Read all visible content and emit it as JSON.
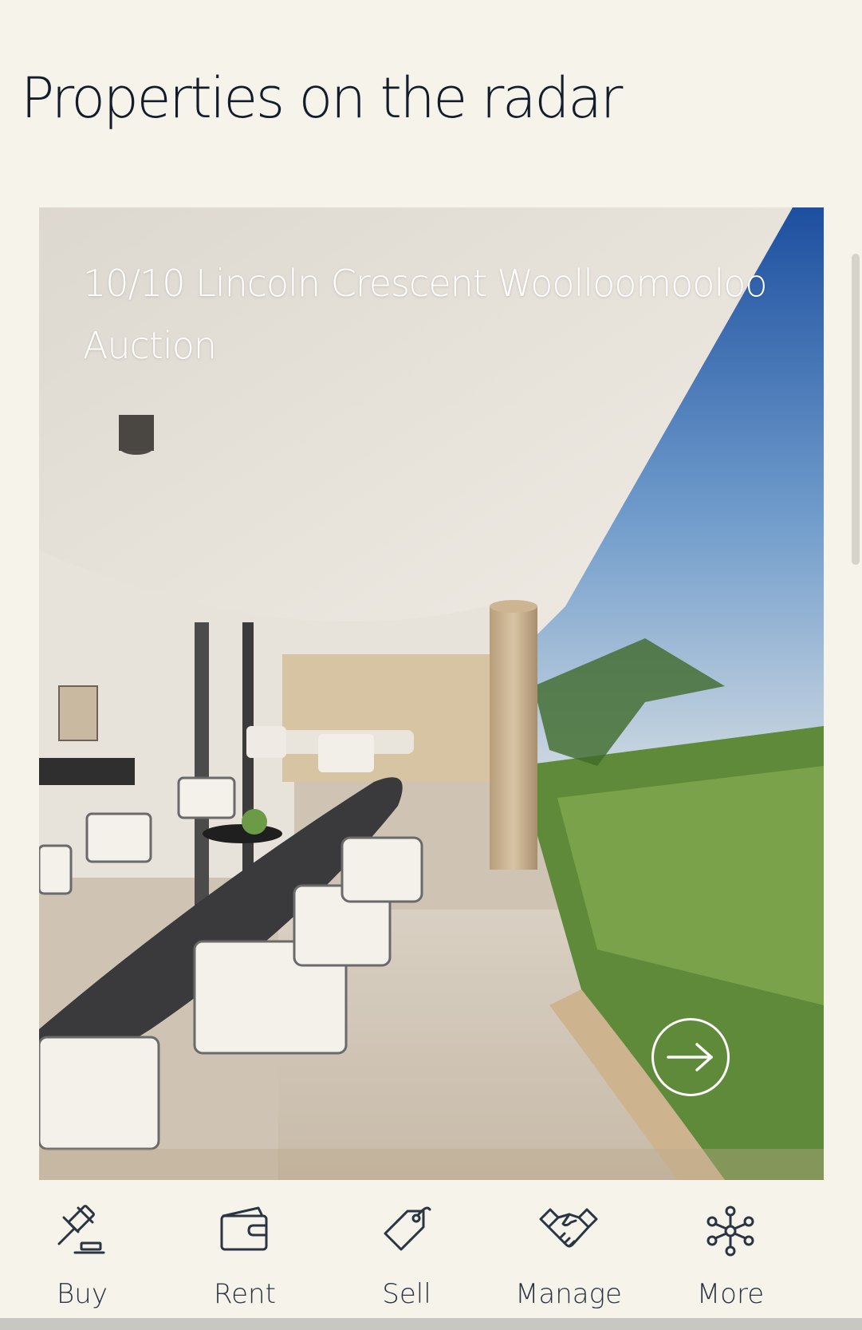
{
  "page": {
    "title": "Properties on the radar"
  },
  "listing": {
    "address": "10/10 Lincoln Crescent Woolloomooloo",
    "sale_method": "Auction",
    "next_icon": "arrow-right-circle-icon"
  },
  "bottom_nav": {
    "items": [
      {
        "label": "Buy",
        "icon": "gavel-icon"
      },
      {
        "label": "Rent",
        "icon": "wallet-icon"
      },
      {
        "label": "Sell",
        "icon": "price-tag-icon"
      },
      {
        "label": "Manage",
        "icon": "handshake-icon"
      },
      {
        "label": "More",
        "icon": "network-icon"
      }
    ]
  },
  "colors": {
    "background": "#f6f4ea",
    "text": "#131c2a",
    "nav_text": "#2b3442",
    "overlay_text": "#ffffff"
  }
}
